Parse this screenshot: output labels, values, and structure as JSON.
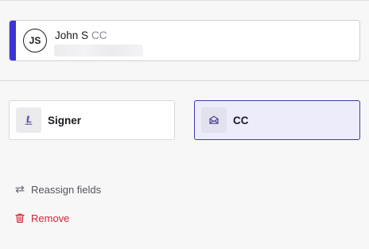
{
  "recipient": {
    "initials": "JS",
    "name": "John S",
    "role": "CC",
    "accent_color": "#3b36d1"
  },
  "roles": {
    "selected": "cc",
    "options": [
      {
        "id": "signer",
        "label": "Signer",
        "icon": "signature-icon"
      },
      {
        "id": "cc",
        "label": "CC",
        "icon": "envelope-open-icon"
      }
    ]
  },
  "actions": {
    "reassign_label": "Reassign fields",
    "reassign_icon": "swap-arrows-icon",
    "remove_label": "Remove",
    "remove_icon": "trash-icon",
    "remove_color": "#d92332"
  }
}
